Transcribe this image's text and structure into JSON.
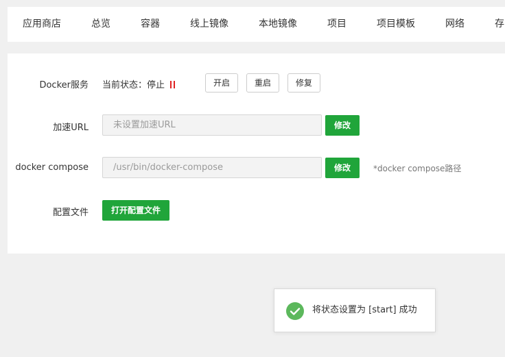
{
  "tabs": [
    "应用商店",
    "总览",
    "容器",
    "线上镜像",
    "本地镜像",
    "项目",
    "项目模板",
    "网络",
    "存"
  ],
  "docker_service": {
    "label": "Docker服务",
    "status_text": "当前状态：停止",
    "status_color": "#e02020",
    "buttons": [
      "开启",
      "重启",
      "修复"
    ]
  },
  "accel_url": {
    "label": "加速URL",
    "placeholder": "未设置加速URL",
    "button": "修改"
  },
  "compose": {
    "label": "docker compose",
    "value": "/usr/bin/docker-compose",
    "button": "修改",
    "hint": "*docker compose路径"
  },
  "config_file": {
    "label": "配置文件",
    "button": "打开配置文件"
  },
  "toast": {
    "message": "将状态设置为 [start] 成功",
    "icon": "check-circle-icon",
    "color": "#5cb85c"
  },
  "colors": {
    "accent": "#20a53a"
  }
}
